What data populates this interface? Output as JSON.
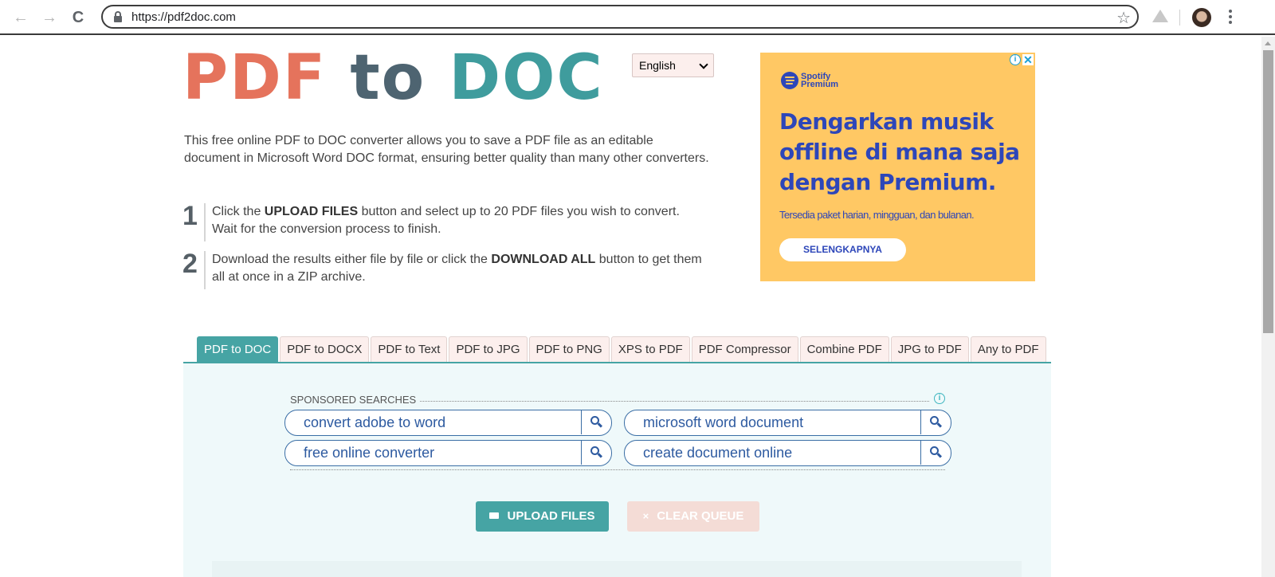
{
  "browser": {
    "url": "https://pdf2doc.com",
    "icons": {
      "back": "arrow-left-icon",
      "forward": "arrow-right-icon",
      "reload": "reload-icon",
      "lock": "lock-icon",
      "bookmark": "star-icon",
      "extension": "google-drive-icon",
      "profile": "avatar",
      "menu": "kebab-menu-icon"
    },
    "glyphs": {
      "back": "←",
      "forward": "→",
      "reload": "C",
      "star": "☆"
    }
  },
  "header": {
    "logo": {
      "part1": "PDF",
      "part2": "to",
      "part3": "DOC"
    },
    "language": {
      "selected": "English"
    }
  },
  "intro": {
    "text": "This free online PDF to DOC converter allows you to save a PDF file as an editable document in Microsoft Word DOC format, ensuring better quality than many other converters."
  },
  "steps": [
    {
      "num": "1",
      "pre": "Click the ",
      "bold": "UPLOAD FILES",
      "post": " button and select up to 20 PDF files you wish to convert. Wait for the conversion process to finish."
    },
    {
      "num": "2",
      "pre": "Download the results either file by file or click the ",
      "bold": "DOWNLOAD ALL",
      "post": " button to get them all at once in a ZIP archive."
    }
  ],
  "ad": {
    "brand_line1": "Spotify",
    "brand_line2": "Premium",
    "headline": "Dengarkan musik offline di mana saja dengan Premium.",
    "sub": "Tersedia paket harian, mingguan, dan bulanan.",
    "cta": "SELENGKAPNYA",
    "adchoices_info": "i",
    "adchoices_close": "✕",
    "colors": {
      "bg": "#ffc864",
      "text": "#2d46b9"
    }
  },
  "tabs": [
    {
      "label": "PDF to DOC",
      "active": true
    },
    {
      "label": "PDF to DOCX",
      "active": false
    },
    {
      "label": "PDF to Text",
      "active": false
    },
    {
      "label": "PDF to JPG",
      "active": false
    },
    {
      "label": "PDF to PNG",
      "active": false
    },
    {
      "label": "XPS to PDF",
      "active": false
    },
    {
      "label": "PDF Compressor",
      "active": false
    },
    {
      "label": "Combine PDF",
      "active": false
    },
    {
      "label": "JPG to PDF",
      "active": false
    },
    {
      "label": "Any to PDF",
      "active": false
    }
  ],
  "sponsored": {
    "label": "SPONSORED SEARCHES",
    "info": "i",
    "searches": [
      "convert adobe to word",
      "microsoft word document",
      "free online converter",
      "create document online"
    ]
  },
  "actions": {
    "upload": "UPLOAD FILES",
    "clear": "CLEAR QUEUE",
    "clear_icon": "×"
  },
  "colors": {
    "accent": "#46a4a4",
    "logo_pdf": "#e5735c",
    "logo_to": "#4e6471",
    "logo_doc": "#3f9c9d",
    "tab_inactive_bg": "#fcefed",
    "panel_bg": "#eff9fa"
  }
}
